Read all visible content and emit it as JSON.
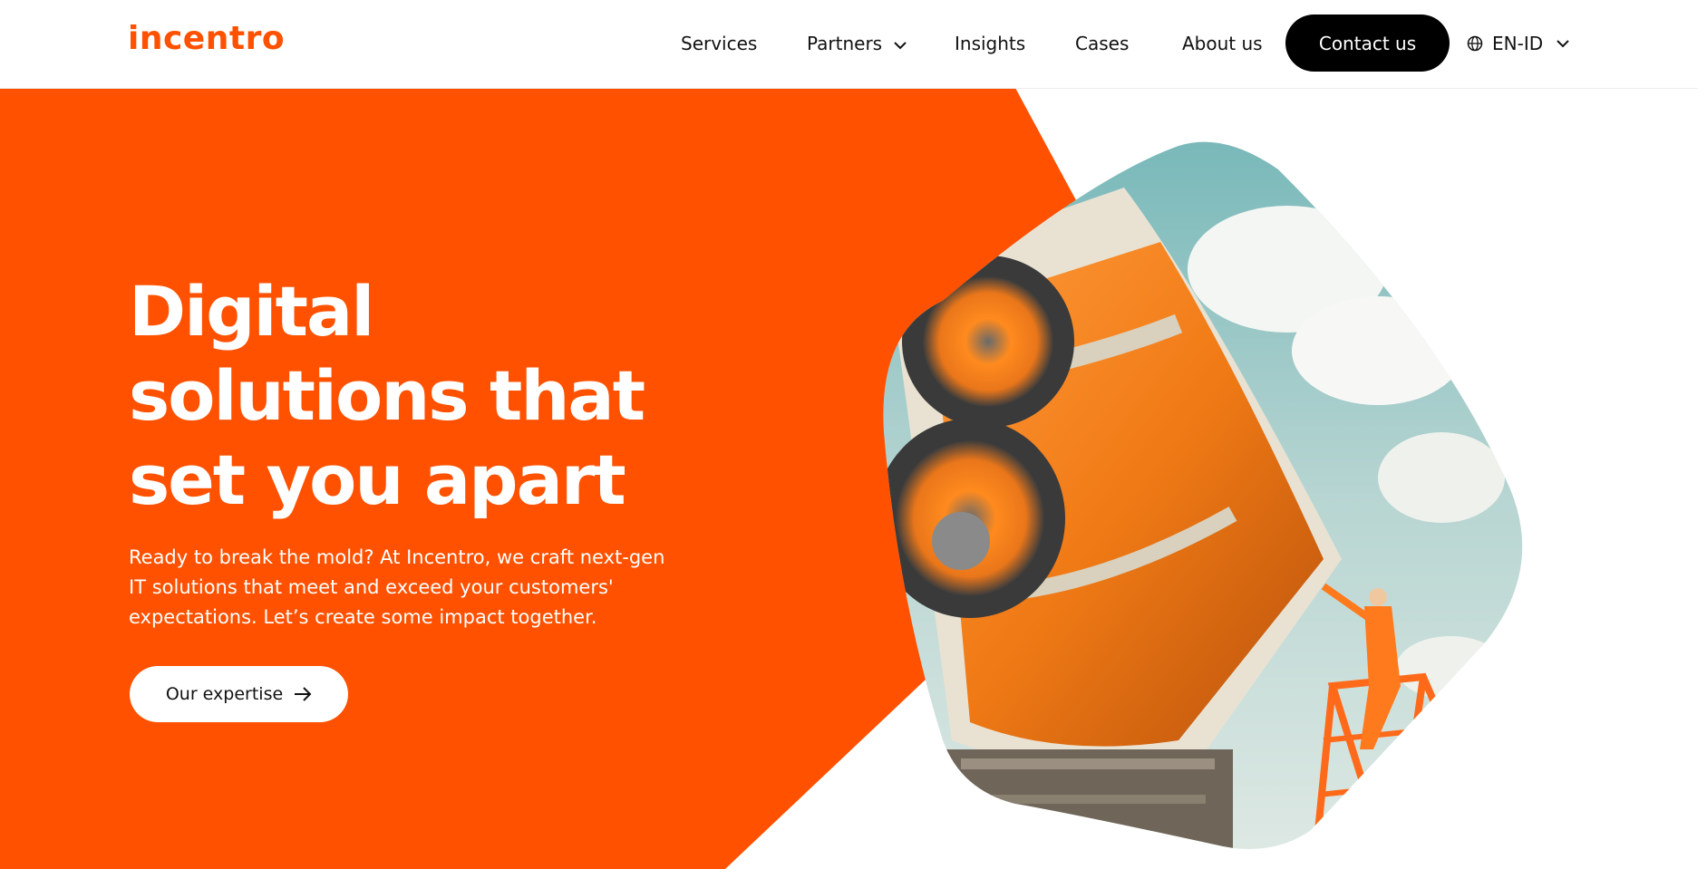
{
  "brand": {
    "logo_text": "incentro",
    "accent": "#ff5100"
  },
  "nav": {
    "items": [
      {
        "label": "Services"
      },
      {
        "label": "Partners",
        "has_dropdown": true
      },
      {
        "label": "Insights"
      },
      {
        "label": "Cases"
      },
      {
        "label": "About us"
      }
    ],
    "contact_label": "Contact us",
    "language": {
      "label": "EN-ID",
      "icon": "globe-icon"
    }
  },
  "hero": {
    "headline": "Digital solutions that set you apart",
    "description": "Ready to break the mold? At Incentro, we craft next-gen IT solutions that meet and exceed your customers' expectations. Let’s create some impact together.",
    "cta_label": "Our expertise",
    "cta_icon": "arrow-right-icon",
    "image_subject": "worker on orange ladder maintaining large orange aircraft engine"
  }
}
